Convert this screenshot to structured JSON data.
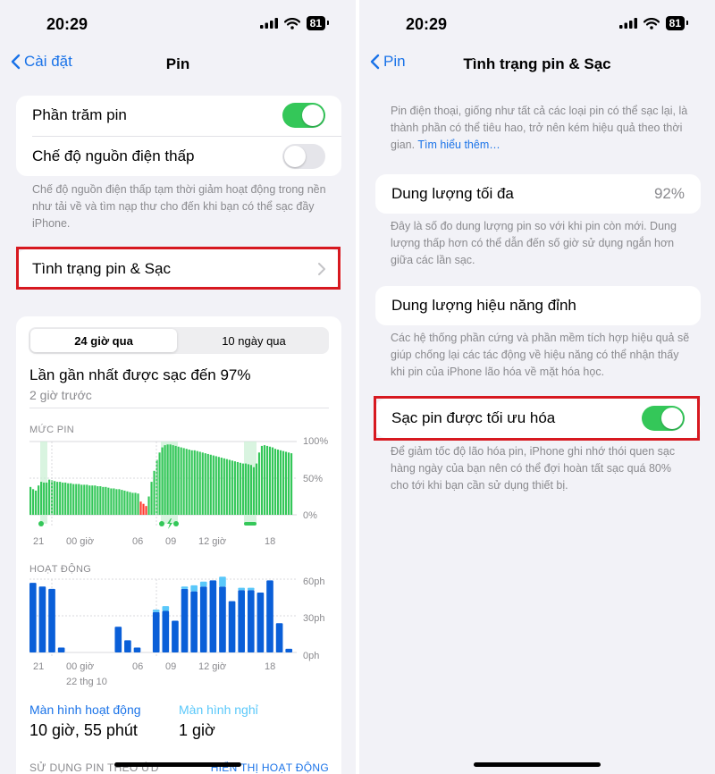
{
  "status": {
    "time": "20:29",
    "battery": "81"
  },
  "left": {
    "back_label": "Cài đặt",
    "title": "Pin",
    "battery_percentage_label": "Phần trăm pin",
    "battery_percentage_on": true,
    "low_power_label": "Chế độ nguồn điện thấp",
    "low_power_on": false,
    "low_power_footer": "Chế độ nguồn điện thấp tạm thời giảm hoạt động trong nền như tải về và tìm nạp thư cho đến khi bạn có thể sạc đầy iPhone.",
    "health_row_label": "Tình trạng pin & Sạc",
    "tabs": [
      "24 giờ qua",
      "10 ngày qua"
    ],
    "last_charged": "Lần gần nhất được sạc đến 97%",
    "last_charged_time": "2 giờ trước",
    "battery_level_caption": "MỨC PIN",
    "battery_y_ticks": [
      "100%",
      "50%",
      "0%"
    ],
    "x_ticks": [
      "21",
      "00 giờ",
      "06",
      "09",
      "12 giờ",
      "18"
    ],
    "date_label": "22 thg 10",
    "activity_caption": "HOẠT ĐỘNG",
    "activity_y_ticks": [
      "60ph",
      "30ph",
      "0ph"
    ],
    "screen_on_label": "Màn hình hoạt động",
    "screen_on_value": "10 giờ, 55 phút",
    "screen_off_label": "Màn hình nghỉ",
    "screen_off_value": "1 giờ",
    "usage_by_app": "SỬ DỤNG PIN THEO ỨD",
    "show_activity": "HIỂN THỊ HOẠT ĐỘNG",
    "chart_colors": {
      "level": "#34c759",
      "low": "#ff3b30",
      "activity": "#0a5fd8",
      "activity_light": "#5ac8fa"
    }
  },
  "right": {
    "back_label": "Pin",
    "title": "Tình trạng pin & Sạc",
    "intro": "Pin điện thoại, giống như tất cả các loại pin có thể sạc lại, là thành phần có thể tiêu hao, trở nên kém hiệu quả theo thời gian.",
    "learn_more": "Tìm hiểu thêm…",
    "max_capacity_label": "Dung lượng tối đa",
    "max_capacity_value": "92%",
    "max_capacity_footer": "Đây là số đo dung lượng pin so với khi pin còn mới. Dung lượng thấp hơn có thể dẫn đến số giờ sử dụng ngắn hơn giữa các lần sạc.",
    "peak_label": "Dung lượng hiệu năng đỉnh",
    "peak_footer": "Các hệ thống phần cứng và phần mềm tích hợp hiệu quả sẽ giúp chống lại các tác động về hiệu năng có thể nhận thấy khi pin của iPhone lão hóa về mặt hóa học.",
    "optimized_label": "Sạc pin được tối ưu hóa",
    "optimized_on": true,
    "optimized_footer": "Để giảm tốc độ lão hóa pin, iPhone ghi nhớ thói quen sạc hàng ngày của bạn nên có thể đợi hoàn tất sạc quá 80% cho tới khi bạn cần sử dụng thiết bị."
  },
  "chart_data": [
    {
      "type": "bar",
      "title": "MỨC PIN",
      "ylim": [
        0,
        100
      ],
      "y_ticks": [
        "100%",
        "50%",
        "0%"
      ],
      "x_ticks": [
        "21",
        "00 giờ",
        "06",
        "09",
        "12 giờ",
        "18"
      ],
      "values": [
        38,
        35,
        33,
        40,
        45,
        44,
        44,
        48,
        47,
        46,
        45,
        45,
        44,
        44,
        43,
        43,
        42,
        42,
        42,
        41,
        41,
        41,
        40,
        40,
        40,
        39,
        39,
        38,
        38,
        37,
        36,
        36,
        35,
        35,
        34,
        33,
        32,
        31,
        30,
        30,
        29,
        18,
        15,
        12,
        25,
        45,
        60,
        75,
        85,
        92,
        95,
        96,
        96,
        95,
        94,
        93,
        92,
        91,
        90,
        89,
        88,
        88,
        87,
        86,
        85,
        84,
        83,
        82,
        81,
        80,
        79,
        78,
        77,
        76,
        75,
        74,
        73,
        72,
        71,
        70,
        70,
        69,
        68,
        65,
        70,
        85,
        94,
        95,
        94,
        93,
        92,
        90,
        89,
        88,
        87,
        86,
        85,
        84
      ]
    },
    {
      "type": "bar",
      "title": "HOẠT ĐỘNG",
      "ylim": [
        0,
        60
      ],
      "y_ticks": [
        "60ph",
        "30ph",
        "0ph"
      ],
      "x_ticks": [
        "21",
        "00 giờ",
        "06",
        "09",
        "12 giờ",
        "18"
      ],
      "series": [
        {
          "values": [
            57,
            54,
            52,
            4,
            0,
            0,
            0,
            0,
            0,
            21,
            10,
            4,
            0,
            33,
            34,
            26,
            52,
            50,
            54,
            59,
            54,
            42,
            51,
            51,
            49,
            59,
            24,
            3
          ]
        },
        {
          "values": [
            0,
            0,
            0,
            0,
            0,
            0,
            0,
            0,
            0,
            0,
            0,
            0,
            0,
            2,
            4,
            0,
            2,
            5,
            4,
            0,
            8,
            0,
            2,
            2,
            0,
            0,
            0,
            0
          ]
        }
      ]
    }
  ]
}
